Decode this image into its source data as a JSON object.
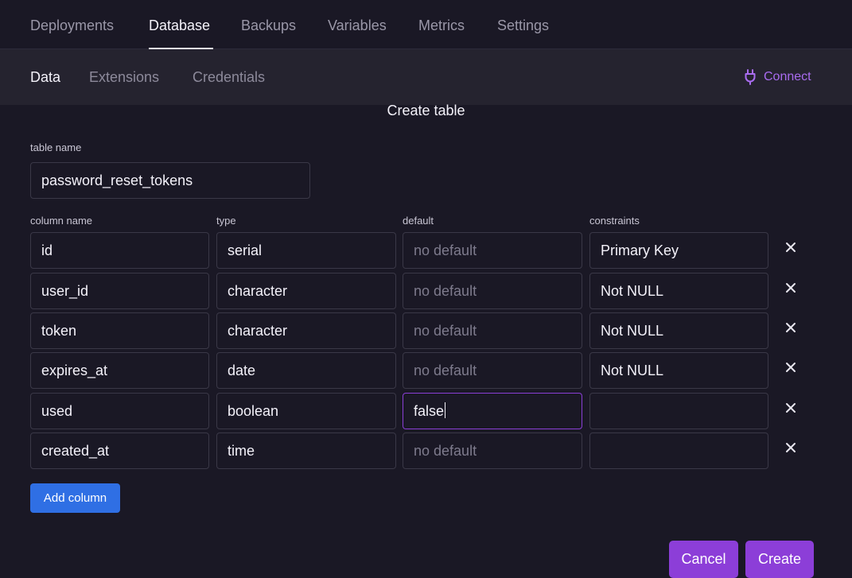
{
  "top_tabs": [
    "Deployments",
    "Database",
    "Backups",
    "Variables",
    "Metrics",
    "Settings"
  ],
  "top_tab_active": "Database",
  "sub_tabs": [
    "Data",
    "Extensions",
    "Credentials"
  ],
  "sub_tab_active": "Data",
  "connect_label": "Connect",
  "colors": {
    "accent": "#a96cf0",
    "primary_button": "#2f6fe4",
    "action_button": "#8c3ed8",
    "background": "#1a1825"
  },
  "form": {
    "title": "Create table",
    "table_name_label": "table name",
    "table_name_value": "password_reset_tokens",
    "headers": {
      "name": "column name",
      "type": "type",
      "default": "default",
      "constraints": "constraints"
    },
    "default_placeholder": "no default",
    "columns": [
      {
        "name": "id",
        "type": "serial",
        "default": "",
        "constraints": "Primary Key"
      },
      {
        "name": "user_id",
        "type": "character",
        "default": "",
        "constraints": "Not NULL"
      },
      {
        "name": "token",
        "type": "character",
        "default": "",
        "constraints": "Not NULL"
      },
      {
        "name": "expires_at",
        "type": "date",
        "default": "",
        "constraints": "Not NULL"
      },
      {
        "name": "used",
        "type": "boolean",
        "default": "false",
        "constraints": ""
      },
      {
        "name": "created_at",
        "type": "time",
        "default": "",
        "constraints": ""
      }
    ],
    "add_column_label": "Add column",
    "cancel_label": "Cancel",
    "create_label": "Create"
  }
}
